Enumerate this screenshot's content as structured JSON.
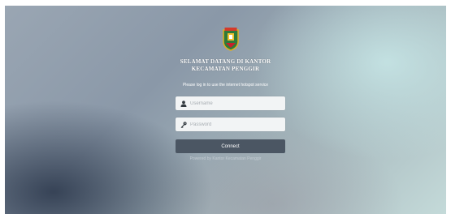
{
  "header": {
    "title_line1": "SELAMAT DATANG DI KANTOR",
    "title_line2": "KECAMATAN PENGGIR",
    "logo_icon": "regional-crest-icon"
  },
  "login": {
    "instruction": "Please log in to use the internet hotspot service",
    "username_placeholder": "Username",
    "password_placeholder": "Password",
    "username_icon": "user-icon",
    "password_icon": "key-icon",
    "connect_label": "Connect"
  },
  "footer": {
    "text": "Powered by Kantor Kecamatan Penggir"
  },
  "colors": {
    "button": "#4b5663",
    "field": "#f2f4f5",
    "text": "#ffffff"
  }
}
